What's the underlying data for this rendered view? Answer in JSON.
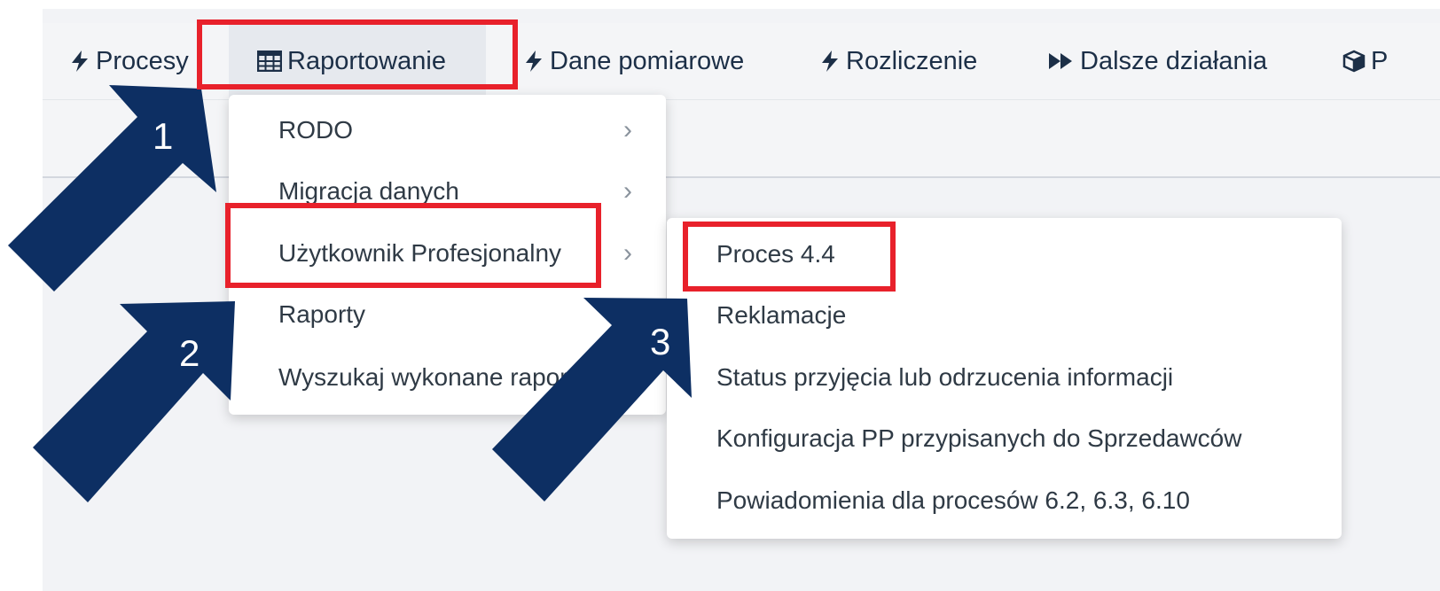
{
  "nav": {
    "items": [
      {
        "label": "Procesy",
        "icon": "bolt-icon"
      },
      {
        "label": "Raportowanie",
        "icon": "table-icon"
      },
      {
        "label": "Dane pomiarowe",
        "icon": "bolt-icon"
      },
      {
        "label": "Rozliczenie",
        "icon": "bolt-icon"
      },
      {
        "label": "Dalsze działania",
        "icon": "fast-forward-icon"
      },
      {
        "label": "P",
        "icon": "cube-icon"
      }
    ]
  },
  "menu": {
    "items": [
      {
        "label": "RODO"
      },
      {
        "label": "Migracja danych"
      },
      {
        "label": "Użytkownik Profesjonalny"
      },
      {
        "label": "Raporty"
      },
      {
        "label": "Wyszukaj wykonane raporty"
      }
    ],
    "chevron": "›"
  },
  "submenu": {
    "items": [
      {
        "label": "Proces 4.4"
      },
      {
        "label": "Reklamacje"
      },
      {
        "label": "Status przyjęcia lub odrzucenia informacji"
      },
      {
        "label": "Konfiguracja PP przypisanych do Sprzedawców"
      },
      {
        "label": "Powiadomienia dla procesów 6.2, 6.3, 6.10"
      }
    ]
  },
  "annotations": {
    "steps": [
      "1",
      "2",
      "3"
    ],
    "highlight_color": "#e8212b",
    "arrow_color": "#0d2f63"
  }
}
